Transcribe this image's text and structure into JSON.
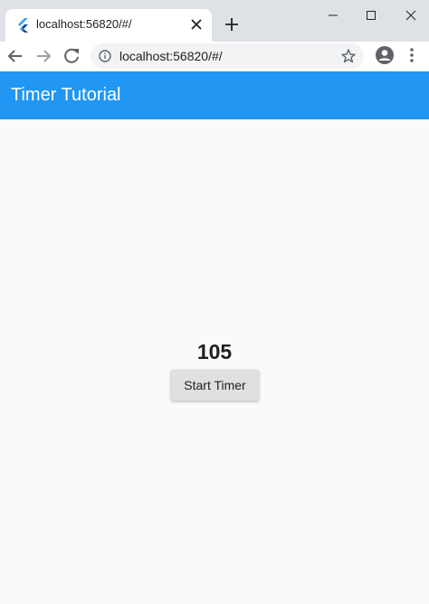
{
  "browser": {
    "tab_title": "localhost:56820/#/",
    "url": "localhost:56820/#/",
    "icons": {
      "favicon": "flutter-icon",
      "tab_close": "close-icon",
      "new_tab": "plus-icon",
      "minimize": "minimize-icon",
      "maximize": "maximize-icon",
      "window_close": "close-icon",
      "back": "arrow-left-icon",
      "forward": "arrow-right-icon",
      "reload": "reload-icon",
      "site_info": "info-icon",
      "bookmark": "star-icon",
      "profile": "account-circle-icon",
      "menu": "more-vert-icon"
    }
  },
  "app": {
    "title": "Timer Tutorial",
    "counter": "105",
    "start_button_label": "Start Timer"
  },
  "colors": {
    "app_bar": "#2196f3",
    "background": "#fafafa",
    "button": "#e0e0e0",
    "tab_strip": "#dee1e6"
  }
}
